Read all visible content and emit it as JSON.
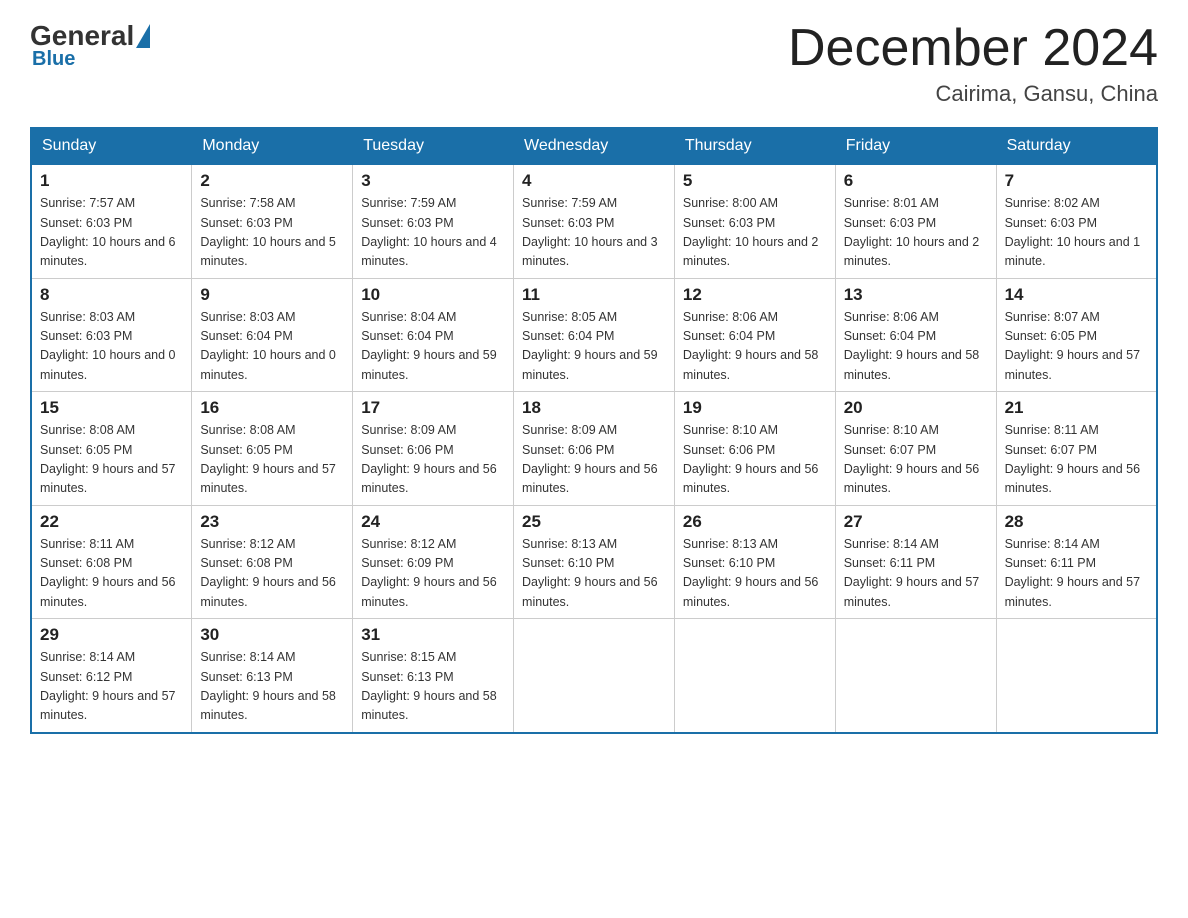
{
  "header": {
    "logo": {
      "general": "General",
      "blue": "Blue"
    },
    "title": "December 2024",
    "location": "Cairima, Gansu, China"
  },
  "days_of_week": [
    "Sunday",
    "Monday",
    "Tuesday",
    "Wednesday",
    "Thursday",
    "Friday",
    "Saturday"
  ],
  "weeks": [
    [
      {
        "day": "1",
        "sunrise": "7:57 AM",
        "sunset": "6:03 PM",
        "daylight": "10 hours and 6 minutes."
      },
      {
        "day": "2",
        "sunrise": "7:58 AM",
        "sunset": "6:03 PM",
        "daylight": "10 hours and 5 minutes."
      },
      {
        "day": "3",
        "sunrise": "7:59 AM",
        "sunset": "6:03 PM",
        "daylight": "10 hours and 4 minutes."
      },
      {
        "day": "4",
        "sunrise": "7:59 AM",
        "sunset": "6:03 PM",
        "daylight": "10 hours and 3 minutes."
      },
      {
        "day": "5",
        "sunrise": "8:00 AM",
        "sunset": "6:03 PM",
        "daylight": "10 hours and 2 minutes."
      },
      {
        "day": "6",
        "sunrise": "8:01 AM",
        "sunset": "6:03 PM",
        "daylight": "10 hours and 2 minutes."
      },
      {
        "day": "7",
        "sunrise": "8:02 AM",
        "sunset": "6:03 PM",
        "daylight": "10 hours and 1 minute."
      }
    ],
    [
      {
        "day": "8",
        "sunrise": "8:03 AM",
        "sunset": "6:03 PM",
        "daylight": "10 hours and 0 minutes."
      },
      {
        "day": "9",
        "sunrise": "8:03 AM",
        "sunset": "6:04 PM",
        "daylight": "10 hours and 0 minutes."
      },
      {
        "day": "10",
        "sunrise": "8:04 AM",
        "sunset": "6:04 PM",
        "daylight": "9 hours and 59 minutes."
      },
      {
        "day": "11",
        "sunrise": "8:05 AM",
        "sunset": "6:04 PM",
        "daylight": "9 hours and 59 minutes."
      },
      {
        "day": "12",
        "sunrise": "8:06 AM",
        "sunset": "6:04 PM",
        "daylight": "9 hours and 58 minutes."
      },
      {
        "day": "13",
        "sunrise": "8:06 AM",
        "sunset": "6:04 PM",
        "daylight": "9 hours and 58 minutes."
      },
      {
        "day": "14",
        "sunrise": "8:07 AM",
        "sunset": "6:05 PM",
        "daylight": "9 hours and 57 minutes."
      }
    ],
    [
      {
        "day": "15",
        "sunrise": "8:08 AM",
        "sunset": "6:05 PM",
        "daylight": "9 hours and 57 minutes."
      },
      {
        "day": "16",
        "sunrise": "8:08 AM",
        "sunset": "6:05 PM",
        "daylight": "9 hours and 57 minutes."
      },
      {
        "day": "17",
        "sunrise": "8:09 AM",
        "sunset": "6:06 PM",
        "daylight": "9 hours and 56 minutes."
      },
      {
        "day": "18",
        "sunrise": "8:09 AM",
        "sunset": "6:06 PM",
        "daylight": "9 hours and 56 minutes."
      },
      {
        "day": "19",
        "sunrise": "8:10 AM",
        "sunset": "6:06 PM",
        "daylight": "9 hours and 56 minutes."
      },
      {
        "day": "20",
        "sunrise": "8:10 AM",
        "sunset": "6:07 PM",
        "daylight": "9 hours and 56 minutes."
      },
      {
        "day": "21",
        "sunrise": "8:11 AM",
        "sunset": "6:07 PM",
        "daylight": "9 hours and 56 minutes."
      }
    ],
    [
      {
        "day": "22",
        "sunrise": "8:11 AM",
        "sunset": "6:08 PM",
        "daylight": "9 hours and 56 minutes."
      },
      {
        "day": "23",
        "sunrise": "8:12 AM",
        "sunset": "6:08 PM",
        "daylight": "9 hours and 56 minutes."
      },
      {
        "day": "24",
        "sunrise": "8:12 AM",
        "sunset": "6:09 PM",
        "daylight": "9 hours and 56 minutes."
      },
      {
        "day": "25",
        "sunrise": "8:13 AM",
        "sunset": "6:10 PM",
        "daylight": "9 hours and 56 minutes."
      },
      {
        "day": "26",
        "sunrise": "8:13 AM",
        "sunset": "6:10 PM",
        "daylight": "9 hours and 56 minutes."
      },
      {
        "day": "27",
        "sunrise": "8:14 AM",
        "sunset": "6:11 PM",
        "daylight": "9 hours and 57 minutes."
      },
      {
        "day": "28",
        "sunrise": "8:14 AM",
        "sunset": "6:11 PM",
        "daylight": "9 hours and 57 minutes."
      }
    ],
    [
      {
        "day": "29",
        "sunrise": "8:14 AM",
        "sunset": "6:12 PM",
        "daylight": "9 hours and 57 minutes."
      },
      {
        "day": "30",
        "sunrise": "8:14 AM",
        "sunset": "6:13 PM",
        "daylight": "9 hours and 58 minutes."
      },
      {
        "day": "31",
        "sunrise": "8:15 AM",
        "sunset": "6:13 PM",
        "daylight": "9 hours and 58 minutes."
      },
      null,
      null,
      null,
      null
    ]
  ]
}
